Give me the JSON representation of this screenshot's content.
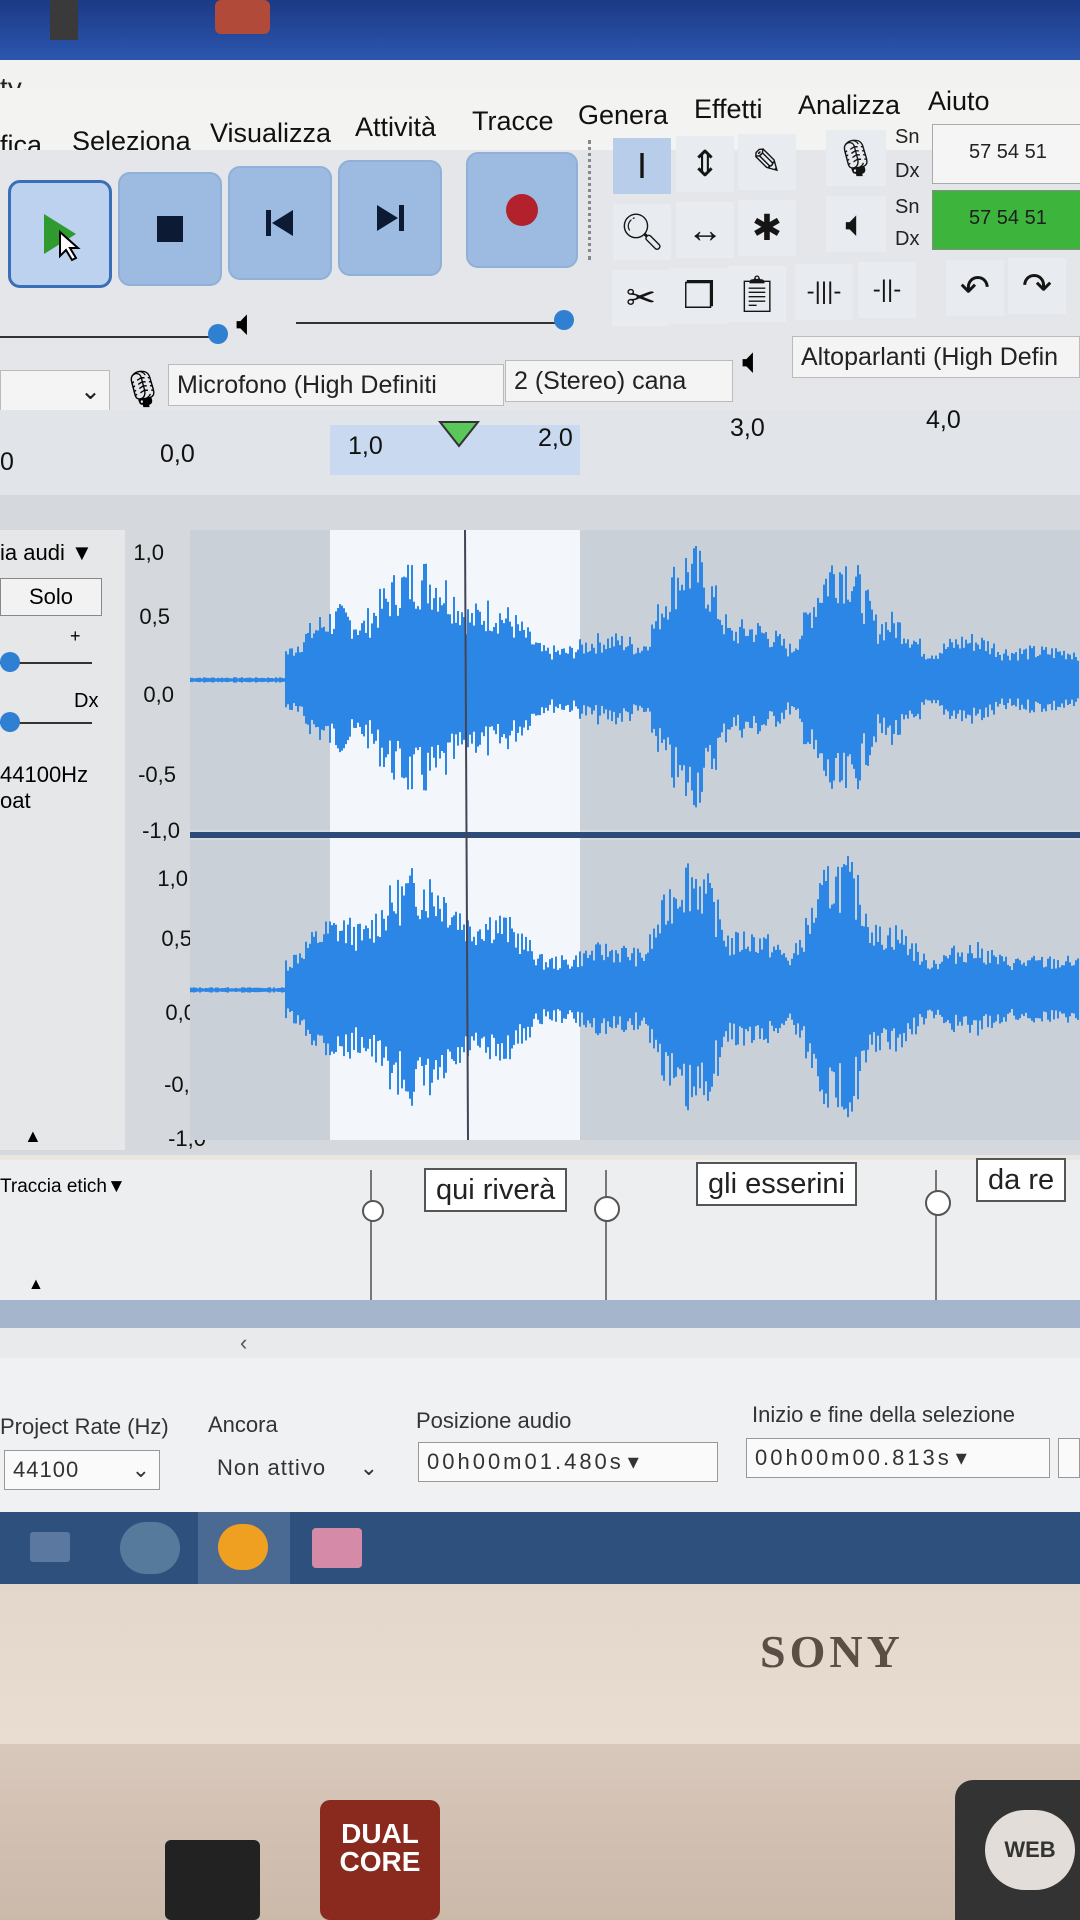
{
  "window": {
    "title_fragment": "ty"
  },
  "menu": [
    "fica",
    "Seleziona",
    "Visualizza",
    "Attività",
    "Tracce",
    "Genera",
    "Effetti",
    "Analizza",
    "Aiuto"
  ],
  "meters": {
    "sn_label": "Sn",
    "dx_label": "Dx",
    "record_scale": "57 54 51",
    "play_scale": "57 54 51"
  },
  "devices": {
    "host": "",
    "mic_device": "Microfono (High Definiti",
    "channels": "2 (Stereo) cana",
    "speaker_device": "Altoparlanti (High Defin"
  },
  "ruler": {
    "ticks": [
      "0",
      "0,0",
      "1,0",
      "2,0",
      "3,0",
      "4,0"
    ]
  },
  "track": {
    "name": "ia audi",
    "solo_label": "Solo",
    "gain_plus": "+",
    "pan_label": "Dx",
    "rate": "44100Hz",
    "format": "oat",
    "scale_top": [
      "1,0",
      "0,5",
      "0,0",
      "-0,5",
      "-1,0"
    ],
    "scale_bottom": [
      "1,0",
      "0,5",
      "0,0",
      "-0,5",
      "-1,0"
    ]
  },
  "label_track": {
    "name": "Traccia etich",
    "labels": [
      "qui riverà",
      "gli esserini",
      "da re"
    ]
  },
  "statusbar": {
    "project_rate_label": "Project Rate (Hz)",
    "project_rate_value": "44100",
    "snap_label": "Ancora",
    "snap_value": "Non attivo",
    "audio_position_label": "Posizione audio",
    "audio_position_value": "00h00m01.480s",
    "selection_label": "Inizio e fine della selezione",
    "selection_start_value": "00h00m00.813s"
  },
  "laptop": {
    "brand": "SONY",
    "sticker_text": "DUAL CORE",
    "web_button": "WEB"
  },
  "colors": {
    "waveform": "#2b86e6",
    "waveform_dark": "#1f6fcc",
    "selection": "#f3f6fb",
    "track_bg": "#c9d0d8",
    "taskbar": "#2d507c"
  }
}
